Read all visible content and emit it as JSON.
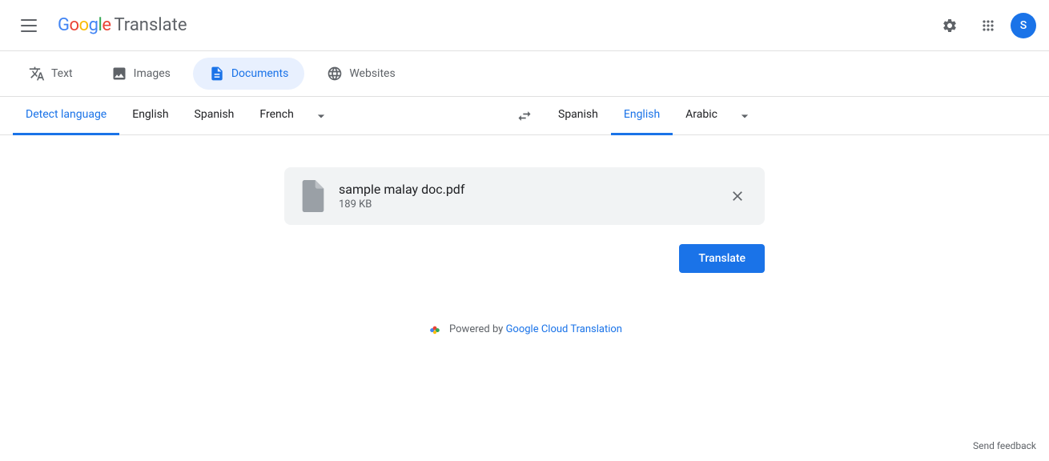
{
  "header": {
    "logo_google": "Google",
    "logo_translate": "Translate",
    "avatar_letter": "S",
    "settings_label": "Settings",
    "apps_label": "Google apps"
  },
  "mode_tabs": [
    {
      "id": "text",
      "label": "Text",
      "icon": "translate"
    },
    {
      "id": "images",
      "label": "Images",
      "icon": "image"
    },
    {
      "id": "documents",
      "label": "Documents",
      "icon": "description",
      "active": true
    },
    {
      "id": "websites",
      "label": "Websites",
      "icon": "language"
    }
  ],
  "source_langs": [
    {
      "id": "detect",
      "label": "Detect language",
      "active": true
    },
    {
      "id": "en",
      "label": "English"
    },
    {
      "id": "es",
      "label": "Spanish"
    },
    {
      "id": "fr",
      "label": "French"
    }
  ],
  "target_langs": [
    {
      "id": "es",
      "label": "Spanish"
    },
    {
      "id": "en",
      "label": "English",
      "active": true
    },
    {
      "id": "ar",
      "label": "Arabic"
    }
  ],
  "file": {
    "name": "sample malay doc.pdf",
    "size": "189 KB"
  },
  "translate_button": "Translate",
  "powered_by": {
    "prefix": "Powered by",
    "link_label": "Google Cloud Translation",
    "link_url": "#"
  },
  "send_feedback": "Send feedback"
}
